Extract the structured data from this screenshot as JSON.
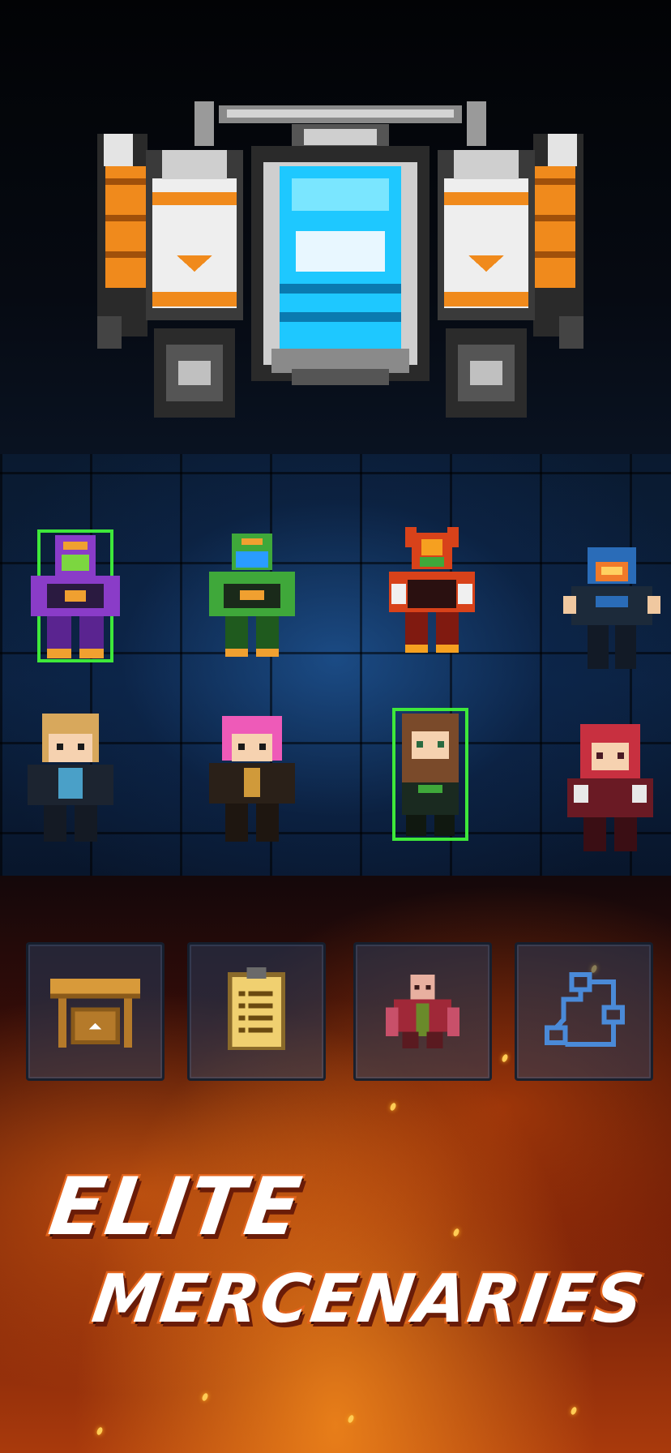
{
  "headline": {
    "line1": "ELITE",
    "line2": "MERCENARIES"
  },
  "ship": {
    "icon": "spaceship-icon",
    "colors": {
      "engine_pod": "#f08a1c",
      "cockpit": "#1ec8ff",
      "hull": "#d8d8d8"
    }
  },
  "mercenaries": [
    {
      "id": "purple-mech",
      "row": 1,
      "selected": true,
      "primary": "#8a3cc8",
      "visor": "#7cd640"
    },
    {
      "id": "green-mech",
      "row": 1,
      "selected": false,
      "primary": "#3fa83a",
      "visor": "#2a9cff"
    },
    {
      "id": "red-mech",
      "row": 1,
      "selected": false,
      "primary": "#d8421a",
      "visor": "#f6a020"
    },
    {
      "id": "blue-helmet-trooper",
      "row": 1,
      "selected": false,
      "primary": "#2a6cb8",
      "visor": "#f07a2a"
    },
    {
      "id": "blonde-pilot",
      "row": 2,
      "selected": false,
      "primary": "#d8a85c",
      "visor": "#2a3a50"
    },
    {
      "id": "pink-hair-pilot",
      "row": 2,
      "selected": false,
      "primary": "#ee5ab8",
      "visor": "#3a2a20"
    },
    {
      "id": "brown-hair-pilot",
      "row": 2,
      "selected": true,
      "primary": "#7a4a2a",
      "visor": "#2a6a40"
    },
    {
      "id": "red-hair-pilot",
      "row": 2,
      "selected": false,
      "primary": "#c83040",
      "visor": "#4a1a24"
    }
  ],
  "menu_buttons": [
    {
      "icon": "workbench-icon"
    },
    {
      "icon": "clipboard-icon"
    },
    {
      "icon": "commander-portrait-icon"
    },
    {
      "icon": "circuit-map-icon"
    }
  ],
  "colors": {
    "selection_outline": "#3ee83a",
    "headline_stroke": "#e2641c",
    "grid_glow": "#1f5a9a"
  }
}
